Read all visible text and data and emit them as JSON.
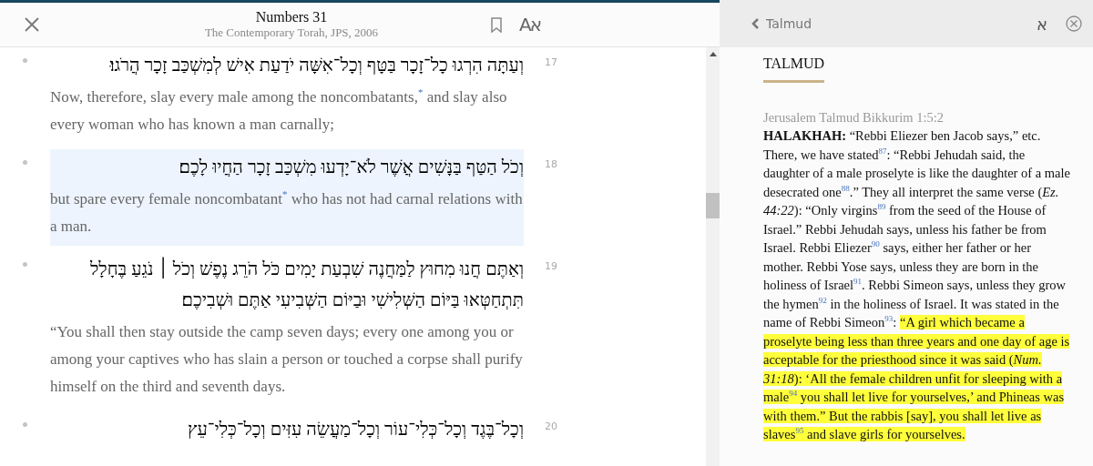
{
  "reader": {
    "title": "Numbers 31",
    "subtitle": "The Contemporary Torah, JPS, 2006",
    "language_toggle": "Aא",
    "verses": [
      {
        "number": "17",
        "selected": false,
        "hebrew": "וְעַתָּה הִרְגוּ כָל־זָכָר בַּטָּף וְכָל־אִשָּׁה יֹדַעַת אִישׁ לְמִשְׁכַּב זָכָר הֲרֹגוּ׃",
        "english": "Now, therefore, slay every male among the noncombatants,$^{*}$ and slay also every woman who has known a man carnally;"
      },
      {
        "number": "18",
        "selected": true,
        "hebrew": "וְכֹל הַטַּף בַּנָּשִׁים אֲשֶׁר לֹא־יָדְעוּ מִשְׁכַּב זָכָר הַחֲיוּ לָכֶם׃",
        "english": "but spare every female noncombatant$^{*}$ who has not had carnal relations with a man."
      },
      {
        "number": "19",
        "selected": false,
        "hebrew": "וְאַתֶּם חֲנוּ מִחוּץ לַמַּחֲנֶה שִׁבְעַת יָמִים כֹּל הֹרֵג נֶפֶשׁ וְכֹל ׀ נֹגֵעַ בֶּחָלָל תִּתְחַטְּאוּ בַּיּוֹם הַשְּׁלִישִׁי וּבַיּוֹם הַשְּׁבִיעִי אַתֶּם וּשְׁבִיכֶם׃",
        "english": "“You shall then stay outside the camp seven days; every one among you or among your captives who has slain a person or touched a corpse shall purify himself on the third and seventh days."
      },
      {
        "number": "20",
        "selected": false,
        "hebrew": "וְכָל־בֶּגֶד וְכָל־כְּלִי־עוֹר וְכָל־מַעֲשֵׂה עִזִּים וְכָל־כְּלִי־עֵץ"
      }
    ]
  },
  "side_panel": {
    "back_label": "Talmud",
    "language_toggle": "א",
    "heading": "TALMUD",
    "source": "Jerusalem Talmud Bikkurim 1:5:2",
    "passage": [
      {
        "highlighted": false,
        "text": "**HALAKHAH:** “Rebbi Eliezer ben Jacob says,” etc. There, we have stated$^{87}$: “Rebbi Jehudah said, the daughter of a male proselyte is like the daughter of a male desecrated one$^{88}$.” They all interpret the same verse (*Ez. 44:22*): “Only virgins$^{89}$ from the seed of the House of Israel.” Rebbi Jehudah says, unless his father be from Israel. Rebbi Eliezer$^{90}$ says, either her father or her mother. Rebbi Yose says, unless they are born in the holiness of Israel$^{91}$. Rebbi Simeon says, unless they grow the hymen$^{92}$ in the holiness of Israel. It was stated in the name of Rebbi Simeon$^{93}$: "
      },
      {
        "highlighted": true,
        "text": "“A girl which became a proselyte being less than three years and one day of age is acceptable for the priesthood since it was said (*Num. 31:18*): ‘All the female children unfit for sleeping with a male$^{94}$ you shall let live for yourselves,’ and Phineas was with them.” But the rabbis [say], you shall let live as slaves$^{95}$ and slave girls for yourselves."
      }
    ]
  }
}
